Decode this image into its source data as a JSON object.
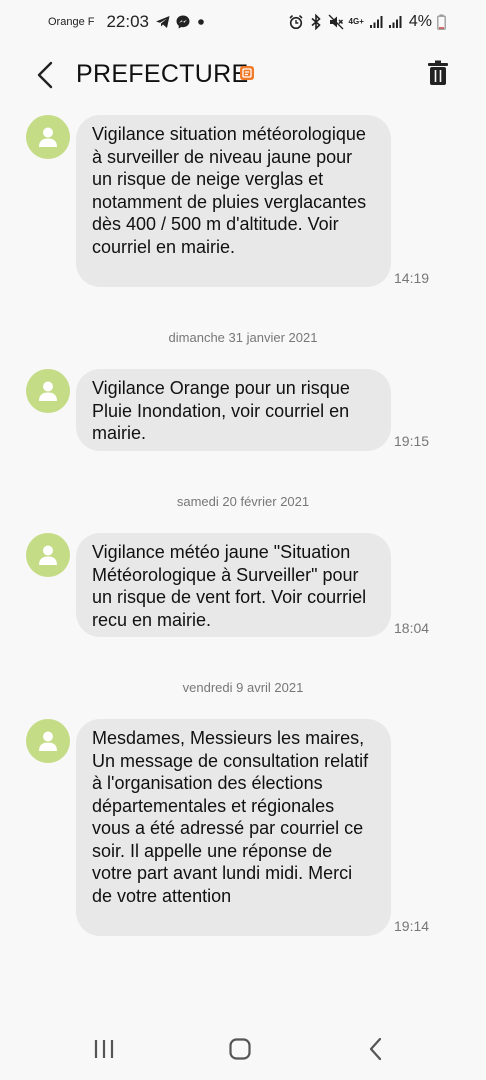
{
  "status_bar": {
    "carrier": "Orange F",
    "time": "22:03",
    "battery": "4%",
    "network": "4G+",
    "left_icons": [
      "telegram-icon",
      "messenger-icon",
      "dot-icon"
    ],
    "right_icons": [
      "alarm-icon",
      "bluetooth-icon",
      "mute-icon",
      "signal-icon",
      "signal-icon",
      "battery-icon"
    ]
  },
  "header": {
    "title": "PREFECTURE",
    "back_icon": "back-arrow-icon",
    "delete_icon": "trash-icon",
    "badge_color": "#f07a28"
  },
  "messages": [
    {
      "text": "Vigilance situation météorologique à surveiller de niveau jaune pour un risque de neige verglas et notamment de pluies verglacantes dès 400 / 500 m d'altitude. Voir courriel en mairie.",
      "time": "14:19"
    },
    {
      "date": "dimanche 31 janvier 2021",
      "text": "Vigilance Orange pour un risque Pluie Inondation, voir courriel en mairie.",
      "time": "19:15"
    },
    {
      "date": "samedi 20 février 2021",
      "text": "Vigilance météo jaune \"Situation Météorologique à Surveiller\" pour un risque de vent fort. Voir courriel recu en mairie.",
      "time": "18:04"
    },
    {
      "date": "vendredi 9 avril 2021",
      "text": "Mesdames, Messieurs les maires,\nUn message de consultation relatif à l'organisation des élections départementales et régionales vous a été adressé par courriel ce soir. Il appelle une réponse de votre part avant lundi midi. Merci de votre attention",
      "time": "19:14"
    }
  ],
  "colors": {
    "avatar_bg": "#c4dc86",
    "bubble_bg": "#e8e8e8",
    "background": "#f8f8f8"
  },
  "nav_bar": {
    "icons": [
      "recent-apps-icon",
      "home-icon",
      "back-icon"
    ]
  }
}
